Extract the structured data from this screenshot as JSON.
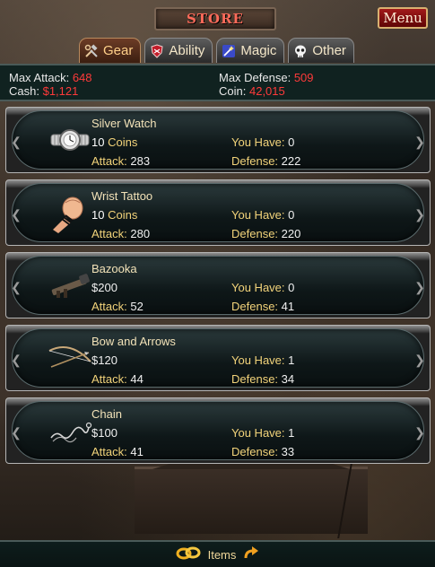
{
  "header": {
    "title": "STORE",
    "menu_label": "Menu"
  },
  "tabs": [
    {
      "label": "Gear",
      "icon": "tools-icon",
      "active": true
    },
    {
      "label": "Ability",
      "icon": "shield-icon",
      "active": false
    },
    {
      "label": "Magic",
      "icon": "magic-icon",
      "active": false
    },
    {
      "label": "Other",
      "icon": "skull-icon",
      "active": false
    }
  ],
  "stats": {
    "max_attack_label": "Max Attack:",
    "max_attack": "648",
    "max_defense_label": "Max Defense:",
    "max_defense": "509",
    "cash_label": "Cash:",
    "cash": "$1,121",
    "coin_label": "Coin:",
    "coin": "42,015"
  },
  "labels": {
    "you_have": "You Have:",
    "attack": "Attack:",
    "defense": "Defense:"
  },
  "items": [
    {
      "name": "Silver Watch",
      "price_num": "10",
      "price_unit": "Coins",
      "price": "",
      "have": "0",
      "attack": "283",
      "defense": "222",
      "icon": "watch-icon"
    },
    {
      "name": "Wrist Tattoo",
      "price_num": "10",
      "price_unit": "Coins",
      "price": "",
      "have": "0",
      "attack": "280",
      "defense": "220",
      "icon": "tattoo-icon"
    },
    {
      "name": "Bazooka",
      "price_num": "",
      "price_unit": "",
      "price": "$200",
      "have": "0",
      "attack": "52",
      "defense": "41",
      "icon": "bazooka-icon"
    },
    {
      "name": "Bow and Arrows",
      "price_num": "",
      "price_unit": "",
      "price": "$120",
      "have": "1",
      "attack": "44",
      "defense": "34",
      "icon": "bow-icon"
    },
    {
      "name": "Chain",
      "price_num": "",
      "price_unit": "",
      "price": "$100",
      "have": "1",
      "attack": "41",
      "defense": "33",
      "icon": "chain-icon"
    }
  ],
  "footer": {
    "items_label": "Items"
  },
  "colors": {
    "stat_value": "#ff3a3a",
    "price_unit": "#f2d37a",
    "menu_button": "#a21a1a"
  }
}
